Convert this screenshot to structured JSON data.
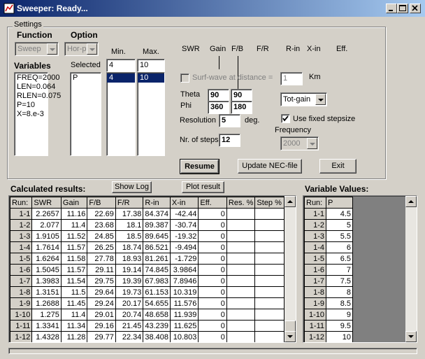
{
  "window": {
    "title": "Sweeper: Ready..."
  },
  "settings": {
    "group_label": "Settings",
    "function_label": "Function",
    "function_value": "Sweep",
    "option_label": "Option",
    "option_value": "Hor-p",
    "variables_label": "Variables",
    "variables": [
      "FREQ=2000",
      "LEN=0.064",
      "RLEN=0.075",
      "P=10",
      "X=8.e-3"
    ],
    "selected_label": "Selected",
    "selected": [
      "P"
    ],
    "min_label": "Min.",
    "min_value": "4",
    "min_list": [
      "4"
    ],
    "max_label": "Max.",
    "max_value": "10",
    "max_list": [
      "10"
    ]
  },
  "output_headers": [
    "SWR",
    "Gain",
    "F/B",
    "F/R",
    "R-in",
    "X-in",
    "Eff."
  ],
  "surf": {
    "label": "Surf-wave at distance =",
    "value": "1",
    "unit": "Km"
  },
  "angles": {
    "theta_label": "Theta",
    "phi_label": "Phi",
    "theta1": "90",
    "theta2": "90",
    "phi1": "360",
    "phi2": "180"
  },
  "gain_select": {
    "value": "Tot-gain"
  },
  "resolution": {
    "label": "Resolution",
    "value": "5",
    "unit": "deg."
  },
  "fixed_step": {
    "label": "Use fixed stepsize",
    "checked": true
  },
  "frequency": {
    "label": "Frequency",
    "value": "2000"
  },
  "steps": {
    "label": "Nr. of steps",
    "value": "12"
  },
  "buttons": {
    "resume": "Resume",
    "update": "Update NEC-file",
    "exit": "Exit",
    "show_log": "Show Log",
    "plot": "Plot result"
  },
  "results": {
    "label": "Calculated results:",
    "columns": [
      "Run:",
      "SWR",
      "Gain",
      "F/B",
      "F/R",
      "R-in",
      "X-in",
      "Eff.",
      "Res. %",
      "Step %"
    ],
    "rows": [
      [
        "1-1",
        "2.2657",
        "11.16",
        "22.69",
        "17.38",
        "84.374",
        "-42.44",
        "0",
        "",
        ""
      ],
      [
        "1-2",
        "2.077",
        "11.4",
        "23.68",
        "18.1",
        "89.387",
        "-30.74",
        "0",
        "",
        ""
      ],
      [
        "1-3",
        "1.9105",
        "11.52",
        "24.85",
        "18.5",
        "89.645",
        "-19.32",
        "0",
        "",
        ""
      ],
      [
        "1-4",
        "1.7614",
        "11.57",
        "26.25",
        "18.74",
        "86.521",
        "-9.494",
        "0",
        "",
        ""
      ],
      [
        "1-5",
        "1.6264",
        "11.58",
        "27.78",
        "18.93",
        "81.261",
        "-1.729",
        "0",
        "",
        ""
      ],
      [
        "1-6",
        "1.5045",
        "11.57",
        "29.11",
        "19.14",
        "74.845",
        "3.9864",
        "0",
        "",
        ""
      ],
      [
        "1-7",
        "1.3983",
        "11.54",
        "29.75",
        "19.39",
        "67.983",
        "7.8946",
        "0",
        "",
        ""
      ],
      [
        "1-8",
        "1.3151",
        "11.5",
        "29.64",
        "19.73",
        "61.153",
        "10.319",
        "0",
        "",
        ""
      ],
      [
        "1-9",
        "1.2688",
        "11.45",
        "29.24",
        "20.17",
        "54.655",
        "11.576",
        "0",
        "",
        ""
      ],
      [
        "1-10",
        "1.275",
        "11.4",
        "29.01",
        "20.74",
        "48.658",
        "11.939",
        "0",
        "",
        ""
      ],
      [
        "1-11",
        "1.3341",
        "11.34",
        "29.16",
        "21.45",
        "43.239",
        "11.625",
        "0",
        "",
        ""
      ],
      [
        "1-12",
        "1.4328",
        "11.28",
        "29.77",
        "22.34",
        "38.408",
        "10.803",
        "0",
        "",
        ""
      ]
    ]
  },
  "varvalues": {
    "label": "Variable Values:",
    "columns": [
      "Run:",
      "P"
    ],
    "rows": [
      [
        "1-1",
        "4.5"
      ],
      [
        "1-2",
        "5"
      ],
      [
        "1-3",
        "5.5"
      ],
      [
        "1-4",
        "6"
      ],
      [
        "1-5",
        "6.5"
      ],
      [
        "1-6",
        "7"
      ],
      [
        "1-7",
        "7.5"
      ],
      [
        "1-8",
        "8"
      ],
      [
        "1-9",
        "8.5"
      ],
      [
        "1-10",
        "9"
      ],
      [
        "1-11",
        "9.5"
      ],
      [
        "1-12",
        "10"
      ]
    ]
  },
  "icons": {
    "minimize": "minimize-icon",
    "maximize": "maximize-icon",
    "close": "close-icon",
    "app": "app-icon"
  },
  "colors": {
    "titlebar": "#0a246a",
    "selection": "#0a246a",
    "face": "#d4d0c8"
  }
}
